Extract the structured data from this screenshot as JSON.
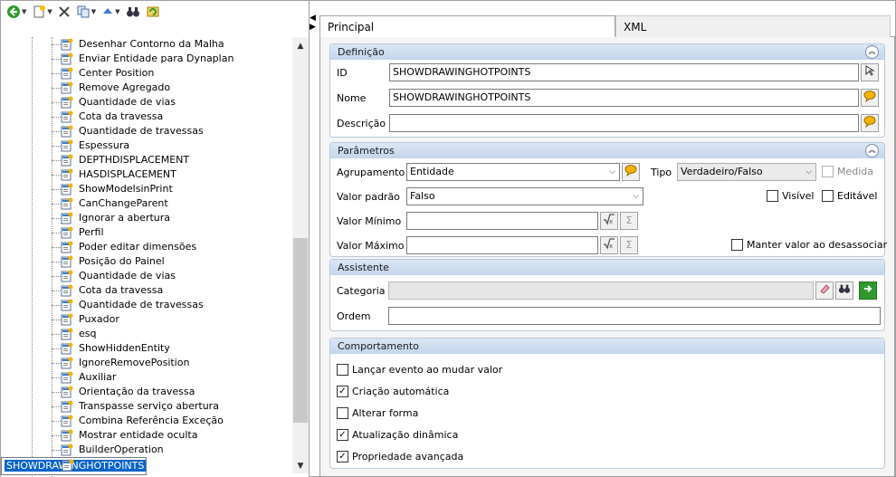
{
  "tree": {
    "items": [
      "Desenhar Contorno da Malha",
      "Enviar Entidade para Dynaplan",
      "Center Position",
      "Remove Agregado",
      "Quantidade de vias",
      "Cota da travessa",
      "Quantidade de travessas",
      "Espessura",
      "DEPTHDISPLACEMENT",
      "HASDISPLACEMENT",
      "ShowModelsinPrint",
      "CanChangeParent",
      "Ignorar a abertura",
      "Perfil",
      "Poder editar dimensões",
      "Posição do Painel",
      "Quantidade de vias",
      "Cota da travessa",
      "Quantidade de travessas",
      "Puxador",
      "esq",
      "ShowHiddenEntity",
      "IgnoreRemovePosition",
      "Auxiliar",
      "Orientação da travessa",
      "Transpasse serviço abertura",
      "Combina Referência Exceção",
      "Mostrar entidade oculta",
      "BuilderOperation",
      "SHOWDRAWINGHOTPOINTS"
    ],
    "selected_index": 29
  },
  "tabs": {
    "principal": "Principal",
    "xml": "XML"
  },
  "definicao": {
    "title": "Definição",
    "id_label": "ID",
    "id_value": "SHOWDRAWINGHOTPOINTS",
    "nome_label": "Nome",
    "nome_value": "SHOWDRAWINGHOTPOINTS",
    "descricao_label": "Descrição",
    "descricao_value": ""
  },
  "parametros": {
    "title": "Parâmetros",
    "agrupamento_label": "Agrupamento",
    "agrupamento_value": "Entidade",
    "tipo_label": "Tipo",
    "tipo_value": "Verdadeiro/Falso",
    "medida_label": "Medida",
    "valor_padrao_label": "Valor padrão",
    "valor_padrao_value": "Falso",
    "visivel_label": "Visível",
    "editavel_label": "Editável",
    "valor_minimo_label": "Valor Mínimo",
    "valor_maximo_label": "Valor Máximo",
    "manter_label": "Manter valor ao desassociar"
  },
  "assistente": {
    "title": "Assistente",
    "categoria_label": "Categoria",
    "ordem_label": "Ordem"
  },
  "comportamento": {
    "title": "Comportamento",
    "items": [
      {
        "label": "Lançar evento ao mudar valor",
        "checked": false
      },
      {
        "label": "Criação automática",
        "checked": true
      },
      {
        "label": "Alterar forma",
        "checked": false
      },
      {
        "label": "Atualização dinâmica",
        "checked": true
      },
      {
        "label": "Propriedade avançada",
        "checked": true
      }
    ]
  }
}
